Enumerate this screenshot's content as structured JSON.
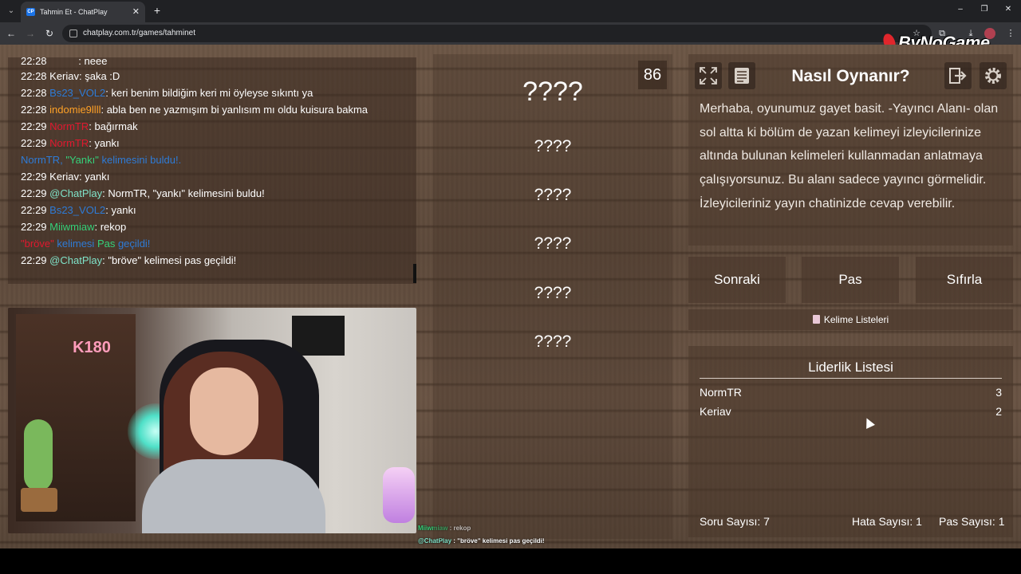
{
  "browser": {
    "tab_title": "Tahmin Et - ChatPlay",
    "tab_favicon_text": "CP",
    "url": "chatplay.com.tr/games/tahminet"
  },
  "brand": {
    "text": "ByNoGame"
  },
  "chat": {
    "partial_top": {
      "time": "22:28",
      "msg": ": neee"
    },
    "lines": [
      {
        "time": "22:28",
        "user": "Keriav",
        "user_color": "#ffffff",
        "msg": ": şaka :D"
      },
      {
        "time": "22:28",
        "user": "Bs23_VOL2",
        "user_color": "#2e7bd6",
        "msg": ": keri benim bildiğim keri mi öyleyse sıkıntı ya"
      },
      {
        "time": "22:28",
        "user": "indomie9llll",
        "user_color": "#ffa126",
        "msg": ": abla ben ne yazmışım bi yanlısım mı oldu kuisura bakma"
      },
      {
        "time": "22:29",
        "user": "NormTR",
        "user_color": "#e0182f",
        "msg": ": bağırmak"
      },
      {
        "time": "22:29",
        "user": "NormTR",
        "user_color": "#e0182f",
        "msg": ": yankı"
      },
      {
        "time": "",
        "user": "",
        "user_color": "#2e7bd6",
        "msg": "NormTR, \"Yankı\" kelimesini buldu!."
      },
      {
        "time": "22:29",
        "user": "Keriav",
        "user_color": "#ffffff",
        "msg": ": yankı"
      },
      {
        "time": "22:29",
        "user": "@ChatPlay",
        "user_color": "#7fe3c9",
        "msg": ": NormTR, \"yankı\" kelimesini buldu!"
      },
      {
        "time": "22:29",
        "user": "Bs23_VOL2",
        "user_color": "#2e7bd6",
        "msg": ": yankı"
      },
      {
        "time": "22:29",
        "user": "Miiwmiaw",
        "user_color": "#35d17a",
        "msg": ": rekop"
      },
      {
        "time": "",
        "user": "",
        "user_color": "#2e7bd6",
        "msg": "\"bröve\" kelimesi Pas geçildi!"
      },
      {
        "time": "22:29",
        "user": "@ChatPlay",
        "user_color": "#7fe3c9",
        "msg": ": \"bröve\" kelimesi pas geçildi!"
      }
    ],
    "pass_parts": {
      "word": "\"bröve\"",
      "mid": " kelimesi ",
      "pas": "Pas",
      "end": " geçildi!"
    },
    "found_parts": {
      "start": "NormTR, ",
      "word": "\"Yankı\"",
      "end": " kelimesini buldu!."
    }
  },
  "overlay_chat": [
    {
      "user": "Miiwmiaw",
      "user_color": "#35d17a",
      "msg": " : rekop"
    },
    {
      "user": "@ChatPlay",
      "user_color": "#7fe3c9",
      "msg": " : \"bröve\" kelimesi pas geçildi!"
    }
  ],
  "webcam": {
    "sign_text": "K180"
  },
  "words": [
    "????",
    "????",
    "????",
    "????",
    "????",
    "????"
  ],
  "timer": "86",
  "info": {
    "title": "Nasıl Oynanır?",
    "text": "Merhaba, oyunumuz gayet basit. -Yayıncı Alanı- olan sol altta ki bölüm de yazan kelimeyi izleyicilerinize altında bulunan kelimeleri kullanmadan anlatmaya çalışıyorsunuz. Bu alanı sadece yayıncı görmelidir. İzleyicileriniz yayın chatinizde cevap verebilir."
  },
  "actions": {
    "next": "Sonraki",
    "pass": "Pas",
    "reset": "Sıfırla"
  },
  "word_lists": "Kelime Listeleri",
  "leaderboard": {
    "title": "Liderlik Listesi",
    "rows": [
      {
        "name": "NormTR",
        "score": "3"
      },
      {
        "name": "Keriav",
        "score": "2"
      }
    ]
  },
  "stats": {
    "questions": "Soru Sayısı: 7",
    "errors": "Hata Sayısı: 1",
    "passes": "Pas Sayısı: 1"
  },
  "icons": {
    "fullscreen": "fullscreen-icon",
    "document": "document-icon",
    "exit": "exit-icon",
    "settings": "gear-icon"
  }
}
